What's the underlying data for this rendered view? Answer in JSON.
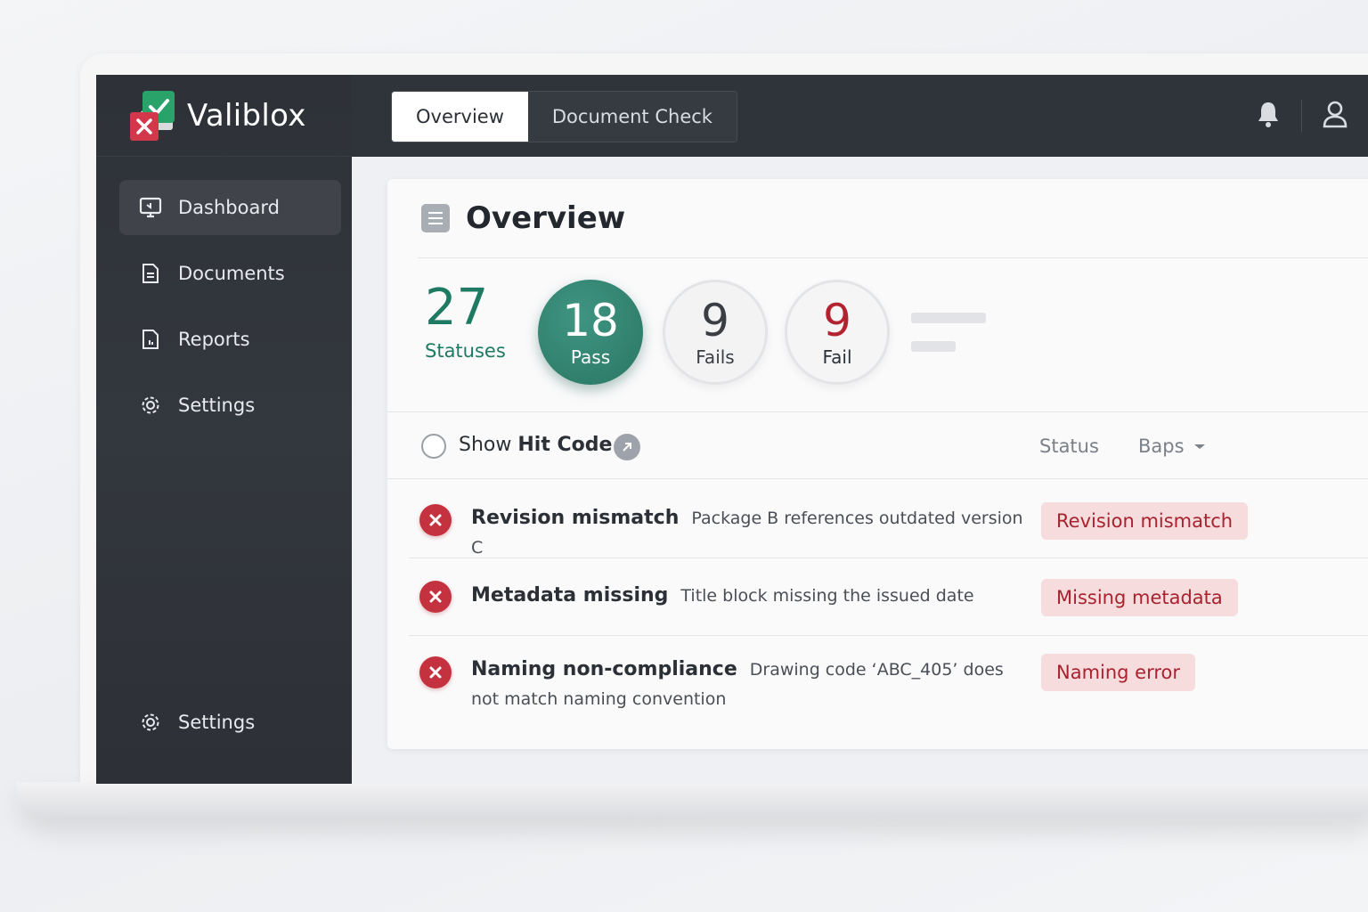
{
  "brand": {
    "name": "Valiblox"
  },
  "topbar": {
    "tabs": [
      {
        "label": "Overview",
        "active": true
      },
      {
        "label": "Document Check",
        "active": false
      }
    ],
    "icons": [
      "bell-icon",
      "user-icon"
    ]
  },
  "sidebar": {
    "items": [
      {
        "label": "Dashboard",
        "icon": "monitor-icon",
        "active": true
      },
      {
        "label": "Documents",
        "icon": "document-icon"
      },
      {
        "label": "Reports",
        "icon": "report-icon"
      },
      {
        "label": "Settings",
        "icon": "gear-icon"
      }
    ],
    "bottom": {
      "label": "Settings",
      "icon": "gear-icon"
    }
  },
  "overview": {
    "title": "Overview",
    "stats": {
      "total": {
        "value": "27",
        "label": "Statuses"
      },
      "pass": {
        "value": "18",
        "label": "Pass"
      },
      "fails": {
        "value": "9",
        "label": "Fails"
      },
      "fail": {
        "value": "9",
        "label": "Fail"
      }
    },
    "filters": {
      "show_prefix": "Show",
      "show_bold": "Hit Code",
      "status_label": "Status",
      "baps_label": "Baps"
    },
    "issues": [
      {
        "title": "Revision mismatch",
        "description": "Package B references outdated version C",
        "badge": "Revision mismatch"
      },
      {
        "title": "Metadata missing",
        "description": "Title block missing the issued date",
        "badge": "Missing metadata"
      },
      {
        "title": "Naming non-compliance",
        "description": "Drawing code ‘ABC_405’ does not match naming convention",
        "badge": "Naming error"
      }
    ]
  },
  "colors": {
    "accent_green": "#2a7664",
    "error_red": "#c5323f",
    "badge_bg": "#f6dcdd",
    "sidebar_bg": "#2e3238"
  }
}
